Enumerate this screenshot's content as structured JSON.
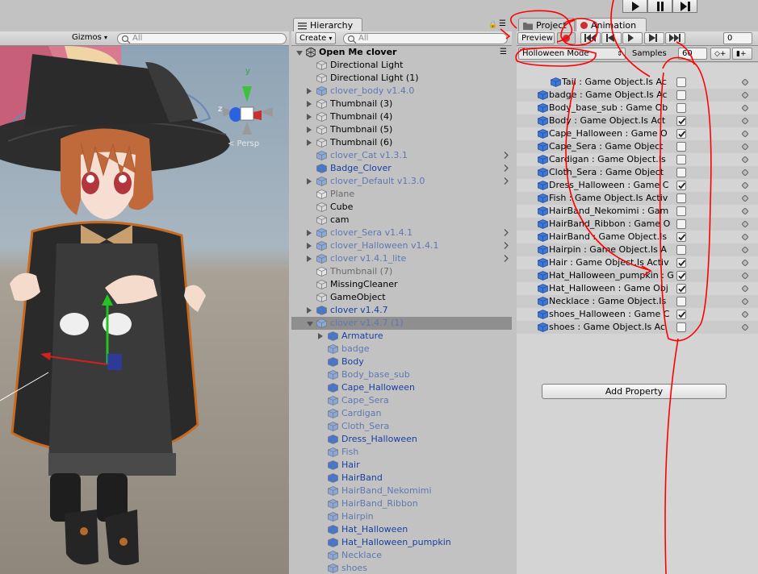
{
  "scene": {
    "gizmos_label": "Gizmos",
    "search_placeholder": "All",
    "persp_label": "< Persp",
    "axis_y": "y",
    "axis_z": "z"
  },
  "hierarchy": {
    "tab_label": "Hierarchy",
    "create_label": "Create",
    "search_placeholder": "All",
    "scene_name": "Open Me clover",
    "rows": [
      {
        "label": "Directional Light",
        "style": "normal"
      },
      {
        "label": "Directional Light (1)",
        "style": "normal"
      },
      {
        "label": "clover_body v1.4.0",
        "style": "prefab-dis"
      },
      {
        "label": "Thumbnail (3)",
        "style": "normal"
      },
      {
        "label": "Thumbnail (4)",
        "style": "normal"
      },
      {
        "label": "Thumbnail (5)",
        "style": "normal"
      },
      {
        "label": "Thumbnail (6)",
        "style": "normal"
      },
      {
        "label": "clover_Cat v1.3.1",
        "style": "prefab-dis"
      },
      {
        "label": "Badge_Clover",
        "style": "prefab"
      },
      {
        "label": "clover_Default v1.3.0",
        "style": "prefab-dis"
      },
      {
        "label": "Plane",
        "style": "dis"
      },
      {
        "label": "Cube",
        "style": "normal"
      },
      {
        "label": "cam",
        "style": "normal"
      },
      {
        "label": "clover_Sera v1.4.1",
        "style": "prefab-dis"
      },
      {
        "label": "clover_Halloween v1.4.1",
        "style": "prefab-dis"
      },
      {
        "label": "clover v1.4.1_lite",
        "style": "prefab-dis"
      },
      {
        "label": "Thumbnail (7)",
        "style": "dis"
      },
      {
        "label": "MissingCleaner",
        "style": "normal"
      },
      {
        "label": "GameObject",
        "style": "normal"
      },
      {
        "label": "clover v1.4.7",
        "style": "prefab"
      },
      {
        "label": "clover v1.4.7 (1)",
        "style": "prefab-dis"
      },
      {
        "label": "Armature",
        "style": "prefab"
      },
      {
        "label": "badge",
        "style": "prefab-dis"
      },
      {
        "label": "Body",
        "style": "prefab"
      },
      {
        "label": "Body_base_sub",
        "style": "prefab-dis"
      },
      {
        "label": "Cape_Halloween",
        "style": "prefab"
      },
      {
        "label": "Cape_Sera",
        "style": "prefab-dis"
      },
      {
        "label": "Cardigan",
        "style": "prefab-dis"
      },
      {
        "label": "Cloth_Sera",
        "style": "prefab-dis"
      },
      {
        "label": "Dress_Halloween",
        "style": "prefab"
      },
      {
        "label": "Fish",
        "style": "prefab-dis"
      },
      {
        "label": "Hair",
        "style": "prefab"
      },
      {
        "label": "HairBand",
        "style": "prefab"
      },
      {
        "label": "HairBand_Nekomimi",
        "style": "prefab-dis"
      },
      {
        "label": "HairBand_Ribbon",
        "style": "prefab-dis"
      },
      {
        "label": "Hairpin",
        "style": "prefab-dis"
      },
      {
        "label": "Hat_Halloween",
        "style": "prefab"
      },
      {
        "label": "Hat_Halloween_pumpkin",
        "style": "prefab"
      },
      {
        "label": "Necklace",
        "style": "prefab-dis"
      },
      {
        "label": "shoes",
        "style": "prefab-dis"
      }
    ]
  },
  "animation": {
    "project_tab": "Project",
    "animation_tab": "Animation",
    "preview_label": "Preview",
    "frame_value": "0",
    "clip_name": "Holloween Mode",
    "samples_label": "Samples",
    "samples_value": "60",
    "add_property_label": "Add Property",
    "properties": [
      {
        "label": "Tail : Game Object.Is Ac",
        "checked": false
      },
      {
        "label": "badge : Game Object.Is Ac",
        "checked": false
      },
      {
        "label": "Body_base_sub : Game Ob",
        "checked": false
      },
      {
        "label": "Body : Game Object.Is Act",
        "checked": true
      },
      {
        "label": "Cape_Halloween : Game O",
        "checked": true
      },
      {
        "label": "Cape_Sera : Game Object",
        "checked": false
      },
      {
        "label": "Cardigan : Game Object.Is",
        "checked": false
      },
      {
        "label": "Cloth_Sera : Game Object",
        "checked": false
      },
      {
        "label": "Dress_Halloween : Game C",
        "checked": true
      },
      {
        "label": "Fish : Game Object.Is Activ",
        "checked": false
      },
      {
        "label": "HairBand_Nekomimi : Gam",
        "checked": false
      },
      {
        "label": "HairBand_Ribbon : Game O",
        "checked": false
      },
      {
        "label": "HairBand : Game Object.Is",
        "checked": true
      },
      {
        "label": "Hairpin : Game Object.Is A",
        "checked": false
      },
      {
        "label": "Hair : Game Object.Is Activ",
        "checked": true
      },
      {
        "label": "Hat_Halloween_pumpkin : G",
        "checked": true
      },
      {
        "label": "Hat_Halloween : Game Obj",
        "checked": true
      },
      {
        "label": "Necklace : Game Object.Is",
        "checked": false
      },
      {
        "label": "shoes_Halloween : Game C",
        "checked": true
      },
      {
        "label": "shoes : Game Object.Is Ac",
        "checked": false
      }
    ]
  },
  "colors": {
    "record_red": "#d12d2d",
    "annotation_red": "#ff0000",
    "prefab_blue": "#1a3fa0",
    "selection_gray": "#8f8f8f"
  }
}
